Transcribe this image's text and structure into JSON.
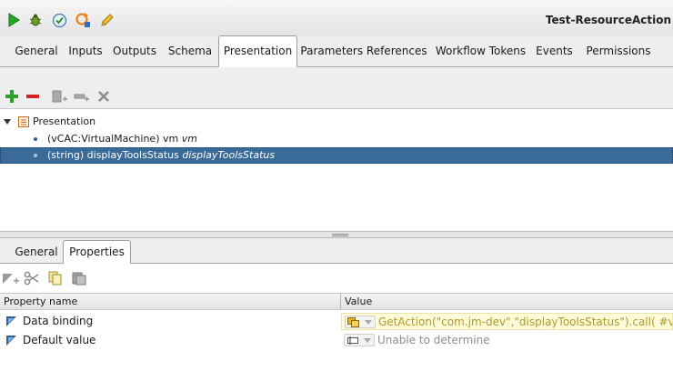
{
  "window": {
    "title": "Test-ResourceAction"
  },
  "top_toolbar": {
    "icons": [
      "run-icon",
      "debug-icon",
      "validate-icon",
      "refresh-icon",
      "edit-icon"
    ]
  },
  "tabs": [
    {
      "label": "General",
      "active": false
    },
    {
      "label": "Inputs",
      "active": false
    },
    {
      "label": "Outputs",
      "active": false
    },
    {
      "label": "Schema",
      "active": false
    },
    {
      "label": "Presentation",
      "active": true
    },
    {
      "label": "Parameters References",
      "active": false
    },
    {
      "label": "Workflow Tokens",
      "active": false
    },
    {
      "label": "Events",
      "active": false
    },
    {
      "label": "Permissions",
      "active": false
    }
  ],
  "action_toolbar": {
    "icons": [
      "add-icon",
      "remove-icon",
      "add-step-icon",
      "add-group-icon",
      "delete-icon"
    ]
  },
  "tree": {
    "root": {
      "label": "Presentation"
    },
    "items": [
      {
        "type_name": "(vCAC:VirtualMachine) vm",
        "param": "vm",
        "selected": false
      },
      {
        "type_name": "(string) displayToolsStatus",
        "param": "displayToolsStatus",
        "selected": true
      }
    ]
  },
  "bottom_tabs": [
    {
      "label": "General",
      "active": false
    },
    {
      "label": "Properties",
      "active": true
    }
  ],
  "properties": {
    "columns": {
      "name": "Property name",
      "value": "Value"
    },
    "rows": [
      {
        "name": "Data binding",
        "value": "GetAction(\"com.jm-dev\",\"displayToolsStatus\").call( #vm )",
        "highlight": true
      },
      {
        "name": "Default value",
        "value": "Unable to determine",
        "highlight": false
      }
    ]
  },
  "colors": {
    "selection": "#3a6a97",
    "binding_text": "#b09a2c",
    "binding_bg": "#fdfbd8",
    "add_green": "#2ca02c",
    "remove_red": "#d42020"
  }
}
